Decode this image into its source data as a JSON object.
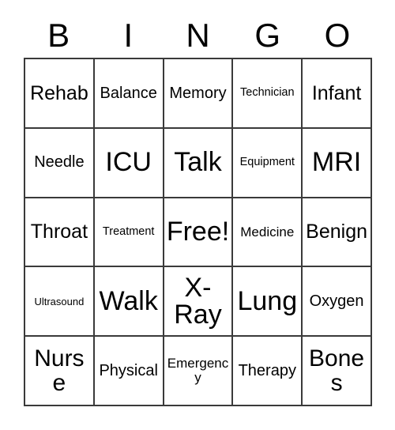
{
  "card": {
    "title": "BINGO",
    "header_letters": [
      "B",
      "I",
      "N",
      "G",
      "O"
    ],
    "free_space_label": "Free!",
    "free_space_position": {
      "row": 3,
      "column": 3
    },
    "grid_size": "5x5",
    "border_color": "#3a3a3a",
    "background_color": "#ffffff",
    "text_color": "#000000",
    "rows": [
      [
        {
          "label": "Rehab",
          "size": "lg"
        },
        {
          "label": "Balance",
          "size": "md"
        },
        {
          "label": "Memory",
          "size": "md"
        },
        {
          "label": "Technician",
          "size": "xs"
        },
        {
          "label": "Infant",
          "size": "lg"
        }
      ],
      [
        {
          "label": "Needle",
          "size": "md"
        },
        {
          "label": "ICU",
          "size": "xxl"
        },
        {
          "label": "Talk",
          "size": "xxl"
        },
        {
          "label": "Equipment",
          "size": "xs"
        },
        {
          "label": "MRI",
          "size": "xxl"
        }
      ],
      [
        {
          "label": "Throat",
          "size": "lg"
        },
        {
          "label": "Treatment",
          "size": "xs"
        },
        {
          "label": "Free!",
          "size": "xxl"
        },
        {
          "label": "Medicine",
          "size": "sm"
        },
        {
          "label": "Benign",
          "size": "lg"
        }
      ],
      [
        {
          "label": "Ultrasound",
          "size": "xxs"
        },
        {
          "label": "Walk",
          "size": "xxl"
        },
        {
          "label": "X-Ray",
          "size": "xxl",
          "wrap": true
        },
        {
          "label": "Lung",
          "size": "xxl"
        },
        {
          "label": "Oxygen",
          "size": "md"
        }
      ],
      [
        {
          "label": "Nurse",
          "size": "xl"
        },
        {
          "label": "Physical",
          "size": "md"
        },
        {
          "label": "Emergency",
          "size": "sm"
        },
        {
          "label": "Therapy",
          "size": "md"
        },
        {
          "label": "Bones",
          "size": "xl"
        }
      ]
    ]
  }
}
